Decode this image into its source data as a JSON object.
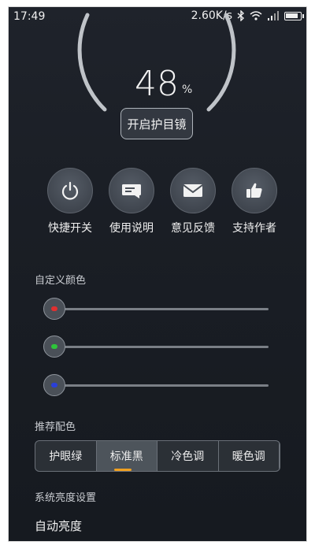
{
  "status_bar": {
    "time": "17:49",
    "net_speed": "2.60K/s",
    "icons": [
      "bluetooth-icon",
      "wifi-icon",
      "signal-icon",
      "battery-icon"
    ],
    "battery_level": 0.9
  },
  "gauge": {
    "value": "48",
    "unit": "%",
    "level": 0.48
  },
  "eye_button": {
    "label": "开启护目镜"
  },
  "actions": [
    {
      "label": "快捷开关",
      "icon": "power-icon"
    },
    {
      "label": "使用说明",
      "icon": "message-icon"
    },
    {
      "label": "意见反馈",
      "icon": "mail-icon"
    },
    {
      "label": "支持作者",
      "icon": "thumbs-up-icon"
    }
  ],
  "custom_color": {
    "title": "自定义颜色",
    "sliders": [
      {
        "channel": "red",
        "dot_color": "#e03030",
        "value": 0.0
      },
      {
        "channel": "green",
        "dot_color": "#2ec43a",
        "value": 0.0
      },
      {
        "channel": "blue",
        "dot_color": "#2a3fd8",
        "value": 0.0
      }
    ]
  },
  "presets": {
    "title": "推荐配色",
    "options": [
      "护眼绿",
      "标准黑",
      "冷色调",
      "暖色调"
    ],
    "selected": "标准黑",
    "accent_color": "#f0a020"
  },
  "brightness": {
    "title": "系统亮度设置",
    "auto_label": "自动亮度"
  }
}
